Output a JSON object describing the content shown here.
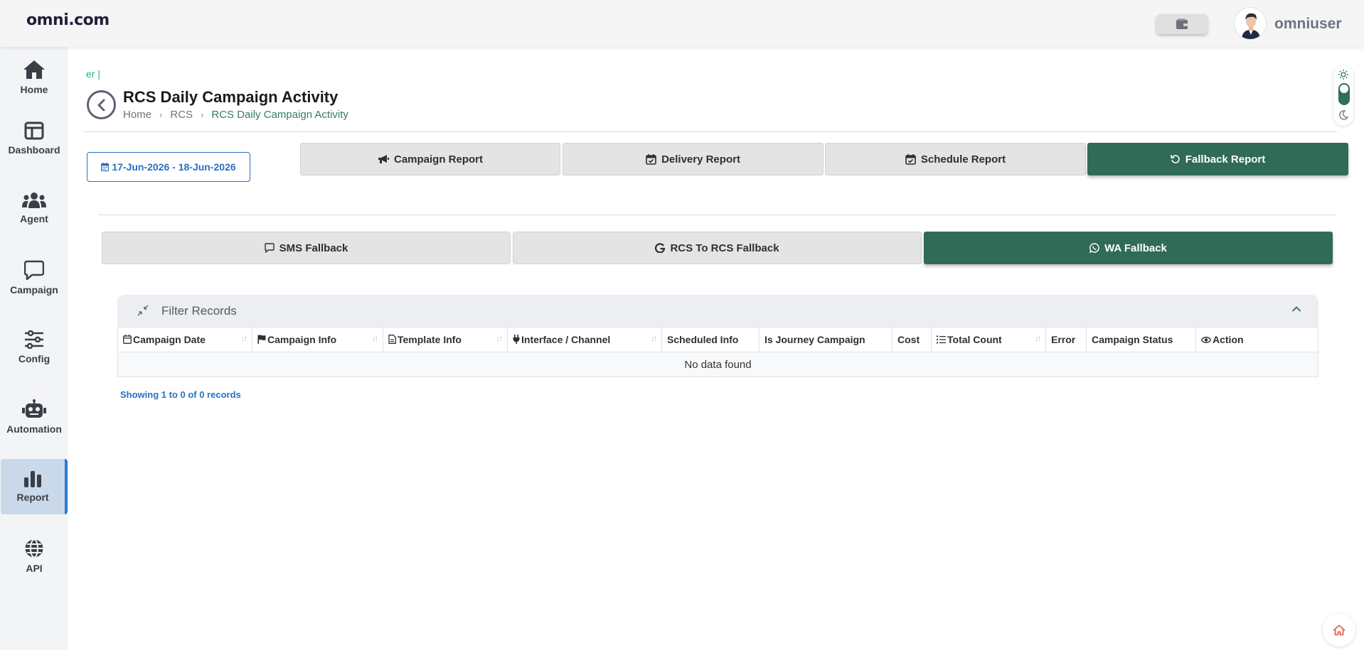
{
  "topbar": {
    "brand": "omni.com",
    "username": "omniuser"
  },
  "sidebar": {
    "items": [
      {
        "label": "Home",
        "icon": "home-icon"
      },
      {
        "label": "Dashboard",
        "icon": "dashboard-icon"
      },
      {
        "label": "Agent",
        "icon": "agent-icon"
      },
      {
        "label": "Campaign",
        "icon": "campaign-icon"
      },
      {
        "label": "Config",
        "icon": "config-icon"
      },
      {
        "label": "Automation",
        "icon": "robot-icon"
      },
      {
        "label": "Report",
        "icon": "bar-chart-icon",
        "active": true
      },
      {
        "label": "API",
        "icon": "globe-icon"
      }
    ]
  },
  "header": {
    "typing_text": "er |",
    "title": "RCS Daily Campaign Activity",
    "breadcrumb": [
      "Home",
      "RCS",
      "RCS Daily Campaign Activity"
    ]
  },
  "date_range": "17-Jun-2026 - 18-Jun-2026",
  "report_tabs": [
    {
      "label": "Campaign Report",
      "icon": "megaphone-icon"
    },
    {
      "label": "Delivery Report",
      "icon": "calendar-check-icon"
    },
    {
      "label": "Schedule Report",
      "icon": "calendar-check-icon"
    },
    {
      "label": "Fallback Report",
      "icon": "rotate-icon",
      "active": true
    }
  ],
  "fallback_tabs": [
    {
      "label": "SMS Fallback",
      "icon": "message-icon"
    },
    {
      "label": "RCS To RCS Fallback",
      "icon": "google-icon"
    },
    {
      "label": "WA Fallback",
      "icon": "whatsapp-icon",
      "active": true
    }
  ],
  "filter": {
    "title": "Filter Records"
  },
  "table": {
    "columns": [
      "Campaign Date",
      "Campaign Info",
      "Template Info",
      "Interface / Channel",
      "Scheduled Info",
      "Is Journey Campaign",
      "Cost",
      "Total Count",
      "Error",
      "Campaign Status",
      "Action"
    ],
    "empty_text": "No data found",
    "showing": "Showing 1 to 0 of 0 records"
  },
  "colors": {
    "accent": "#2f6b57",
    "link": "#2a6fc2",
    "active_nav_bg": "#c9d9e9"
  }
}
